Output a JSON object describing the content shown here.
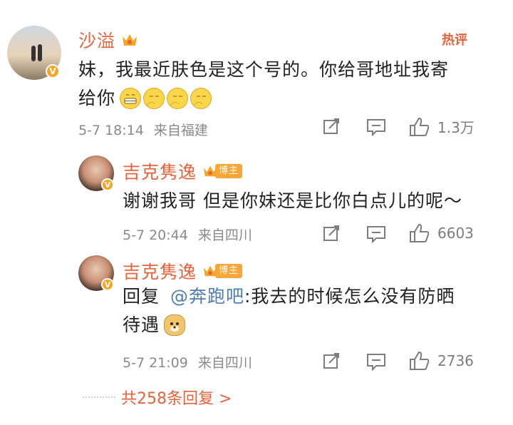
{
  "hot_label": "热评",
  "main_comment": {
    "user": "沙溢",
    "text_line1": "妹，我最近肤色是这个号的。你给哥地址我寄",
    "text_line2": "给你",
    "emojis": [
      "grin-emoji",
      "think-emoji",
      "think-emoji",
      "think-emoji"
    ],
    "time": "5-7 18:14",
    "location": "来自福建",
    "likes": "1.3万"
  },
  "replies": [
    {
      "user": "吉克隽逸",
      "badge": "博主",
      "text": "谢谢我哥 但是你妹还是比你白点儿的呢～",
      "time": "5-7 20:44",
      "location": "来自四川",
      "likes": "6603"
    },
    {
      "user": "吉克隽逸",
      "badge": "博主",
      "reply_prefix": "回复",
      "mention": "@奔跑吧",
      "text_line1": ":我去的时候怎么没有防晒",
      "text_line2": "待遇",
      "emoji": "doge-emoji",
      "time": "5-7 21:09",
      "location": "来自四川",
      "likes": "2736"
    }
  ],
  "more_replies": "共258条回复 >",
  "colors": {
    "accent": "#e8623a",
    "meta": "#8a8a8a",
    "mention": "#507daf",
    "crown": "#f5a623"
  }
}
